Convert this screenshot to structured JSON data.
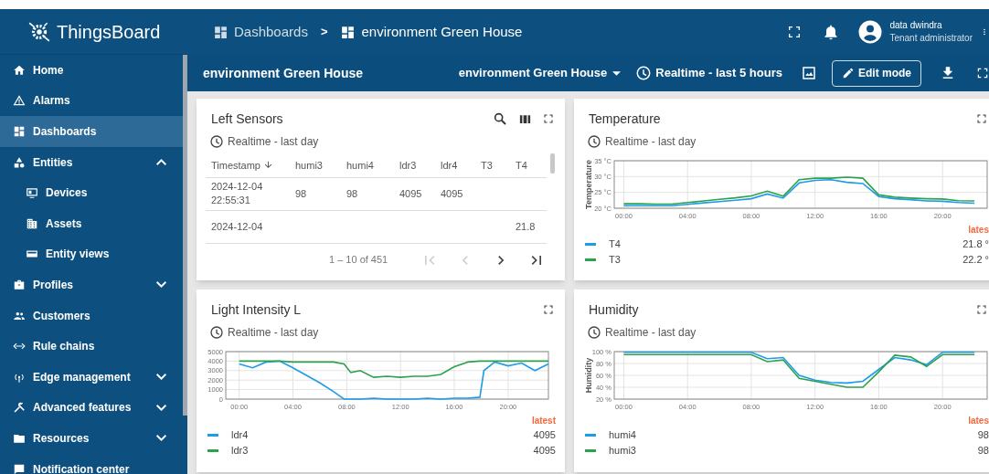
{
  "sidebar": {
    "logo": "ThingsBoard",
    "items": [
      {
        "label": "Home",
        "kind": "link",
        "selected": false
      },
      {
        "label": "Alarms",
        "kind": "link",
        "selected": false
      },
      {
        "label": "Dashboards",
        "kind": "link",
        "selected": true
      },
      {
        "label": "Entities",
        "kind": "group",
        "selected": false,
        "expanded": true,
        "children": [
          {
            "label": "Devices",
            "kind": "link",
            "selected": false
          },
          {
            "label": "Assets",
            "kind": "link",
            "selected": false
          },
          {
            "label": "Entity views",
            "kind": "link",
            "selected": false
          }
        ]
      },
      {
        "label": "Profiles",
        "kind": "group",
        "selected": false,
        "expanded": false
      },
      {
        "label": "Customers",
        "kind": "link",
        "selected": false
      },
      {
        "label": "Rule chains",
        "kind": "link",
        "selected": false
      },
      {
        "label": "Edge management",
        "kind": "group",
        "selected": false,
        "expanded": false
      },
      {
        "label": "Advanced features",
        "kind": "group",
        "selected": false,
        "expanded": false
      },
      {
        "label": "Resources",
        "kind": "group",
        "selected": false,
        "expanded": false
      },
      {
        "label": "Notification center",
        "kind": "link",
        "selected": false
      }
    ]
  },
  "header": {
    "breadcrumbs": [
      "Dashboards",
      "environment Green House"
    ],
    "separator": ">",
    "user": {
      "name": "data dwindra",
      "role": "Tenant administrator"
    }
  },
  "toolbar": {
    "title": "environment Green House",
    "dashboard_select": "environment Green House",
    "timewindow": "Realtime - last 5 hours",
    "edit_button": "Edit mode"
  },
  "widgets": [
    {
      "kind": "table",
      "title": "Left Sensors",
      "timewindow": "Realtime - last day",
      "columns": [
        {
          "label": "Timestamp",
          "sorted": true
        },
        {
          "label": "humi3",
          "sorted": false
        },
        {
          "label": "humi4",
          "sorted": false
        },
        {
          "label": "ldr3",
          "sorted": false
        },
        {
          "label": "ldr4",
          "sorted": false
        },
        {
          "label": "T3",
          "sorted": false
        },
        {
          "label": "T4",
          "sorted": false
        }
      ],
      "rows": [
        {
          "cells": [
            "2024-12-04 22:55:31",
            "98",
            "98",
            "4095",
            "4095",
            null,
            null
          ]
        },
        {
          "cells": [
            "2024-12-04",
            null,
            null,
            null,
            null,
            null,
            "21.8"
          ]
        }
      ],
      "paginator": {
        "range": "1 – 10 of 451",
        "buttons": [
          {
            "kind": "first",
            "disabled": true
          },
          {
            "kind": "prev",
            "disabled": true
          },
          {
            "kind": "next",
            "disabled": false
          },
          {
            "kind": "last",
            "disabled": false
          }
        ]
      }
    },
    {
      "kind": "chart",
      "title": "Temperature",
      "timewindow": "Realtime - last day",
      "legend": {
        "header": "lates",
        "values": [
          "21.8 °",
          "22.2 °"
        ]
      },
      "chart_data": {
        "type": "line",
        "grid": true,
        "ylabel": "Temperature",
        "x": [
          0,
          1,
          2,
          3,
          4,
          5,
          6,
          7,
          8,
          9,
          10,
          11,
          12,
          13,
          14,
          15,
          16,
          17,
          18,
          19,
          20,
          21,
          22
        ],
        "xlim": [
          -0.6,
          22.8
        ],
        "ylim": [
          20,
          35
        ],
        "xticks": [
          {
            "value": 0,
            "label": "00:00"
          },
          {
            "value": 4,
            "label": "04:00"
          },
          {
            "value": 8,
            "label": "08:00"
          },
          {
            "value": 12,
            "label": "12:00"
          },
          {
            "value": 16,
            "label": "16:00"
          },
          {
            "value": 20,
            "label": "20:00"
          }
        ],
        "yticks": [
          {
            "value": 20,
            "label": "20 °C"
          },
          {
            "value": 25,
            "label": "25 °C"
          },
          {
            "value": 30,
            "label": "30 °C"
          },
          {
            "value": 35,
            "label": "35 °C"
          }
        ],
        "series": [
          {
            "name": "T4",
            "color": "#1e9be9",
            "values": [
              20.8,
              20.8,
              20.8,
              20.8,
              21.2,
              21.7,
              22.1,
              22.5,
              23,
              24.5,
              23.2,
              28,
              28.8,
              29,
              28.2,
              27.8,
              23.7,
              23,
              22.7,
              22.3,
              22.2,
              21.8,
              21.6
            ]
          },
          {
            "name": "T3",
            "color": "#2ca24d",
            "values": [
              21.4,
              21.4,
              21.3,
              21.3,
              21.8,
              22.3,
              22.8,
              23.3,
              23.9,
              25.4,
              23.8,
              29,
              29.5,
              29.5,
              29.8,
              29.5,
              24.2,
              23.5,
              23.2,
              23,
              22.9,
              22.4,
              22.3
            ]
          }
        ]
      }
    },
    {
      "kind": "chart",
      "title": "Light Intensity L",
      "timewindow": "Realtime - last day",
      "legend": {
        "header": "latest",
        "values": [
          "4095",
          "4095"
        ]
      },
      "chart_data": {
        "type": "line",
        "grid": true,
        "x": [
          0,
          1,
          2,
          3,
          4,
          5,
          6,
          7,
          7.8,
          8.3,
          9,
          10,
          11,
          12,
          13,
          14,
          15,
          16,
          17,
          17.9,
          18.2,
          19,
          20,
          21,
          22,
          23
        ],
        "xlim": [
          -1,
          23
        ],
        "ylim": [
          0,
          5000
        ],
        "xticks": [
          {
            "value": 0,
            "label": "00:00"
          },
          {
            "value": 4,
            "label": "04:00"
          },
          {
            "value": 8,
            "label": "08:00"
          },
          {
            "value": 12,
            "label": "12:00"
          },
          {
            "value": 16,
            "label": "16:00"
          },
          {
            "value": 20,
            "label": "20:00"
          }
        ],
        "yticks": [
          0,
          1000,
          2000,
          3000,
          4000,
          5000
        ],
        "series": [
          {
            "name": "ldr4",
            "color": "#1e9be9",
            "values": [
              3700,
              3300,
              3900,
              4000,
              3300,
              2500,
              1700,
              800,
              0,
              0,
              0,
              100,
              0,
              0,
              0,
              100,
              0,
              100,
              100,
              200,
              3000,
              3900,
              3500,
              3800,
              3000,
              3700
            ]
          },
          {
            "name": "ldr3",
            "color": "#2ca24d",
            "values": [
              4000,
              4000,
              4000,
              4000,
              3900,
              3900,
              3900,
              3900,
              3700,
              2800,
              3000,
              2300,
              2400,
              2300,
              2400,
              2400,
              2600,
              3400,
              3900,
              4000,
              4000,
              4000,
              4000,
              4000,
              4000,
              4000
            ]
          }
        ]
      }
    },
    {
      "kind": "chart",
      "title": "Humidity",
      "timewindow": "Realtime - last day",
      "legend": {
        "header": "lates",
        "values": [
          "98",
          "98"
        ]
      },
      "chart_data": {
        "type": "line",
        "grid": true,
        "ylabel": "Humidity",
        "x": [
          0,
          1,
          2,
          3,
          4,
          5,
          6,
          7,
          8,
          9,
          10,
          11,
          12,
          13,
          14,
          15,
          16,
          17,
          18,
          19,
          20,
          21,
          22
        ],
        "xlim": [
          -0.6,
          22.8
        ],
        "ylim": [
          20,
          100
        ],
        "xticks": [
          {
            "value": 0,
            "label": "00:00"
          },
          {
            "value": 4,
            "label": "04:00"
          },
          {
            "value": 8,
            "label": "08:00"
          },
          {
            "value": 12,
            "label": "12:00"
          },
          {
            "value": 16,
            "label": "16:00"
          },
          {
            "value": 20,
            "label": "20:00"
          }
        ],
        "yticks": [
          {
            "value": 20,
            "label": "20 %"
          },
          {
            "value": 40,
            "label": "40 %"
          },
          {
            "value": 60,
            "label": "60 %"
          },
          {
            "value": 80,
            "label": "80 %"
          },
          {
            "value": 100,
            "label": "100 %"
          }
        ],
        "series": [
          {
            "name": "humi4",
            "color": "#1e9be9",
            "values": [
              99,
              99,
              99,
              99,
              99,
              99,
              99,
              99,
              99,
              88,
              90,
              60,
              52,
              48,
              47,
              50,
              70,
              90,
              86,
              78,
              99,
              99,
              99
            ]
          },
          {
            "name": "humi3",
            "color": "#2ca24d",
            "values": [
              95,
              95,
              95,
              95,
              95,
              95,
              95,
              95,
              95,
              83,
              86,
              55,
              50,
              45,
              40,
              40,
              66,
              94,
              91,
              75,
              95,
              95,
              95
            ]
          }
        ]
      }
    }
  ]
}
